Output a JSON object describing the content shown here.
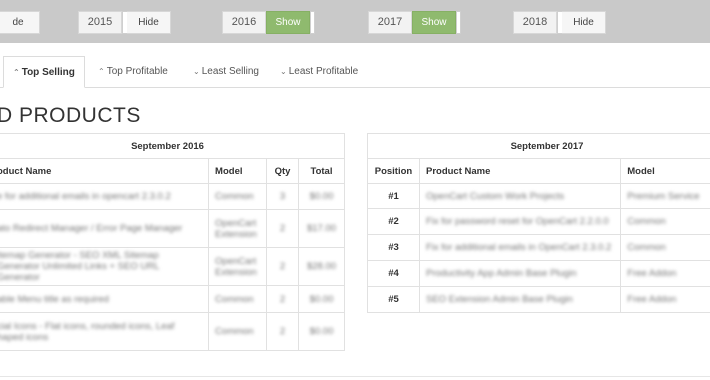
{
  "year_toggles": [
    {
      "year": "",
      "button": "de",
      "state": "off"
    },
    {
      "year": "2015",
      "button": "Hide",
      "state": "off"
    },
    {
      "year": "2016",
      "button": "Show",
      "state": "on"
    },
    {
      "year": "2017",
      "button": "Show",
      "state": "on"
    },
    {
      "year": "2018",
      "button": "Hide",
      "state": "off"
    }
  ],
  "tabs": [
    {
      "label": "Top Selling",
      "icon": "chevron-up-icon",
      "active": true
    },
    {
      "label": "Top Profitable",
      "icon": "chevron-up-icon",
      "active": false
    },
    {
      "label": "Least Selling",
      "icon": "chevron-down-icon",
      "active": false
    },
    {
      "label": "Least Profitable",
      "icon": "chevron-down-icon",
      "active": false
    }
  ],
  "heading": "D PRODUCTS",
  "table_2016": {
    "month": "September 2016",
    "columns": {
      "product": "oduct Name",
      "model": "Model",
      "qty": "Qty",
      "total": "Total"
    },
    "rows": [
      {
        "product": "e for additional emails in opencart 2.3.0.2",
        "model": "Common",
        "qty": "3",
        "total": "$0.00"
      },
      {
        "product": "ato Redirect Manager / Error Page Manager",
        "model": "OpenCart Extension",
        "qty": "2",
        "total": "$17.00"
      },
      {
        "product": "itemap Generator - SEO XML Sitemap Generator Unlimited Links + SEO URL Generator",
        "model": "OpenCart Extension",
        "qty": "2",
        "total": "$28.00"
      },
      {
        "product": "able Menu title as required",
        "model": "Common",
        "qty": "2",
        "total": "$0.00"
      },
      {
        "product": "cial Icons - Flat icons, rounded icons, Leaf haped icons",
        "model": "Common",
        "qty": "2",
        "total": "$0.00"
      }
    ]
  },
  "table_2017": {
    "month": "September 2017",
    "columns": {
      "position": "Position",
      "product": "Product Name",
      "model": "Model"
    },
    "rows": [
      {
        "position": "#1",
        "product": "OpenCart Custom Work Projects",
        "model": "Premium Service"
      },
      {
        "position": "#2",
        "product": "Fix for password reset for OpenCart 2.2.0.0",
        "model": "Common"
      },
      {
        "position": "#3",
        "product": "Fix for additional emails in OpenCart 2.3.0.2",
        "model": "Common"
      },
      {
        "position": "#4",
        "product": "Productivity App Admin Base Plugin",
        "model": "Free Addon"
      },
      {
        "position": "#5",
        "product": "SEO Extension Admin Base Plugin",
        "model": "Free Addon"
      }
    ]
  }
}
